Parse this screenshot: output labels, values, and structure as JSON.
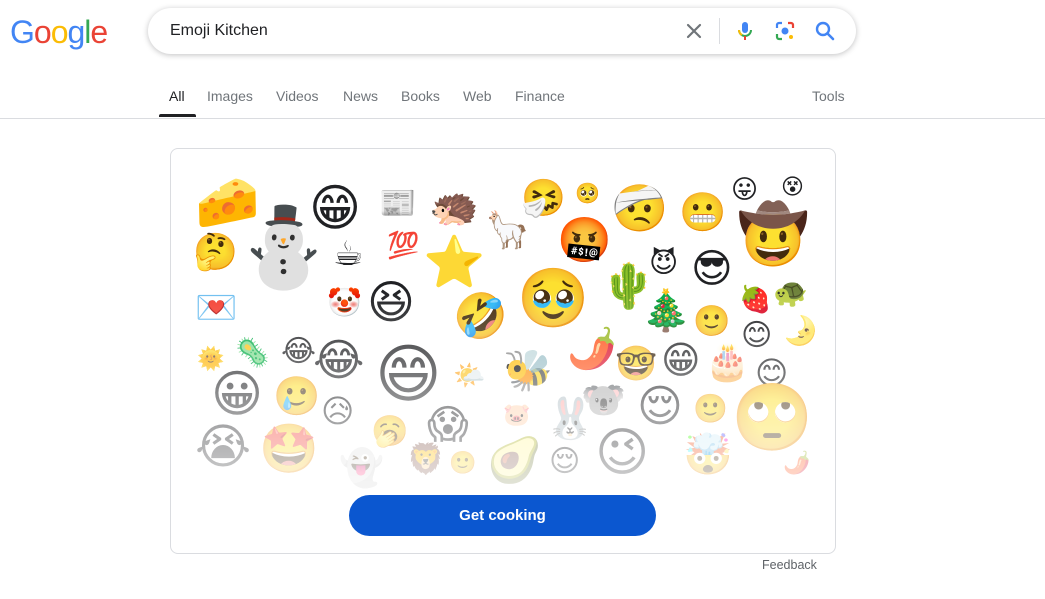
{
  "logo": {
    "letters": [
      "G",
      "o",
      "o",
      "g",
      "l",
      "e"
    ],
    "colors": [
      "#4285F4",
      "#EA4335",
      "#FBBC05",
      "#4285F4",
      "#34A853",
      "#EA4335"
    ]
  },
  "search": {
    "query": "Emoji Kitchen",
    "icons": [
      "close-icon",
      "microphone-icon",
      "lens-icon",
      "search-icon"
    ]
  },
  "tabs": [
    {
      "label": "All",
      "active": true
    },
    {
      "label": "Images"
    },
    {
      "label": "Videos"
    },
    {
      "label": "News"
    },
    {
      "label": "Books"
    },
    {
      "label": "Web"
    },
    {
      "label": "Finance"
    }
  ],
  "tools_label": "Tools",
  "emoji_kitchen": {
    "cta_label": "Get cooking",
    "button_color": "#0b57d0"
  },
  "feedback_label": "Feedback"
}
